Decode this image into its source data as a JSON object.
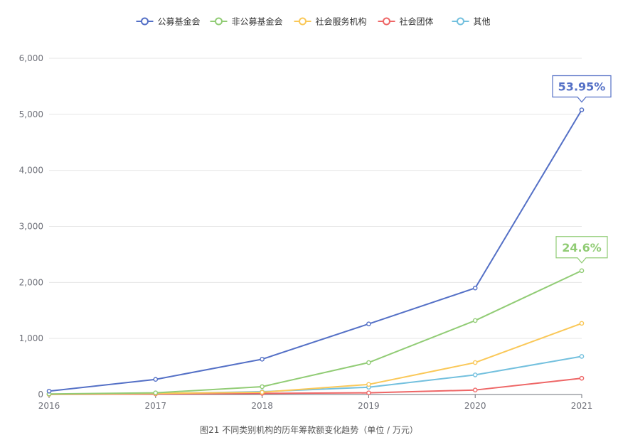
{
  "chart_data": {
    "type": "line",
    "categories": [
      "2016",
      "2017",
      "2018",
      "2019",
      "2020",
      "2021"
    ],
    "ylim": [
      0,
      6000
    ],
    "yticks": [
      "0",
      "1,000",
      "2,000",
      "3,000",
      "4,000",
      "5,000",
      "6,000"
    ],
    "grid": true,
    "legend_position": "top",
    "series": [
      {
        "name": "公募基金会",
        "color": "#5470c6",
        "values": [
          60,
          270,
          630,
          1260,
          1900,
          5080
        ]
      },
      {
        "name": "非公募基金会",
        "color": "#91cc75",
        "values": [
          10,
          30,
          140,
          570,
          1320,
          2210
        ]
      },
      {
        "name": "社会服务机构",
        "color": "#fac858",
        "values": [
          5,
          20,
          40,
          180,
          570,
          1270
        ]
      },
      {
        "name": "社会团体",
        "color": "#ee6666",
        "values": [
          2,
          10,
          20,
          30,
          80,
          290
        ]
      },
      {
        "name": "其他",
        "color": "#73c0de",
        "values": [
          5,
          15,
          50,
          130,
          350,
          680
        ]
      }
    ],
    "annotations": [
      {
        "series": 0,
        "category": "2021",
        "text": "53.95%"
      },
      {
        "series": 1,
        "category": "2021",
        "text": "24.6%"
      }
    ]
  },
  "caption": "图21  不同类别机构的历年筹款额变化趋势（单位 / 万元）"
}
